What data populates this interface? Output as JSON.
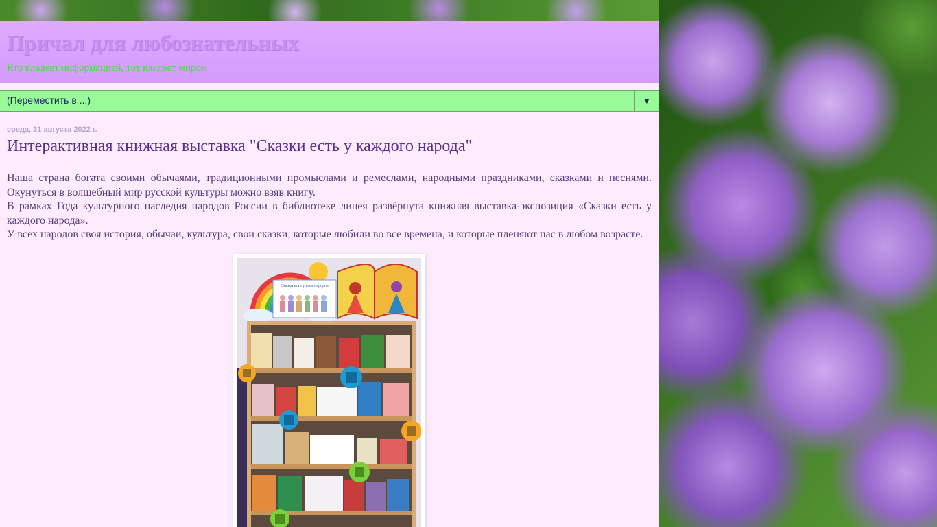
{
  "blog": {
    "title": "Причал для любознательных",
    "description": "Кто владеет информацией, тот владеет миром"
  },
  "nav": {
    "select_value": "(Переместить в ...)",
    "arrow": "▼"
  },
  "post": {
    "date": "среда, 31 августа 2022 г.",
    "title": "Интерактивная книжная выставка \"Сказки есть у каждого народа\"",
    "paragraphs": [
      "Наша страна богата своими обычаями, традиционными промыслами и ремеслами, народными праздниками, сказками и песнями. Окунуться в волшебный мир русской культуры можно взяв книгу.",
      "В рамках Года культурного наследия народов России в библиотеке лицея развёрнута книжная выставка-экспозиция «Сказки есть у каждого народа».",
      "У всех народов своя история, обычаи, культура, свои сказки, которые любили во все времена, и которые пленяют нас в любом возрасте."
    ],
    "photo": {
      "description": "книжная выставка на стеллаже с радугой",
      "banner_text": "Сказки есть у всех народов"
    }
  },
  "colors": {
    "page_bg": "#fcecfe",
    "header_bg": "#d49bfc",
    "title": "#ca8ef0",
    "description": "#4fd94f",
    "nav_bg": "#98fb98",
    "post_title": "#5c2d91",
    "post_body": "#5a3d7a"
  }
}
